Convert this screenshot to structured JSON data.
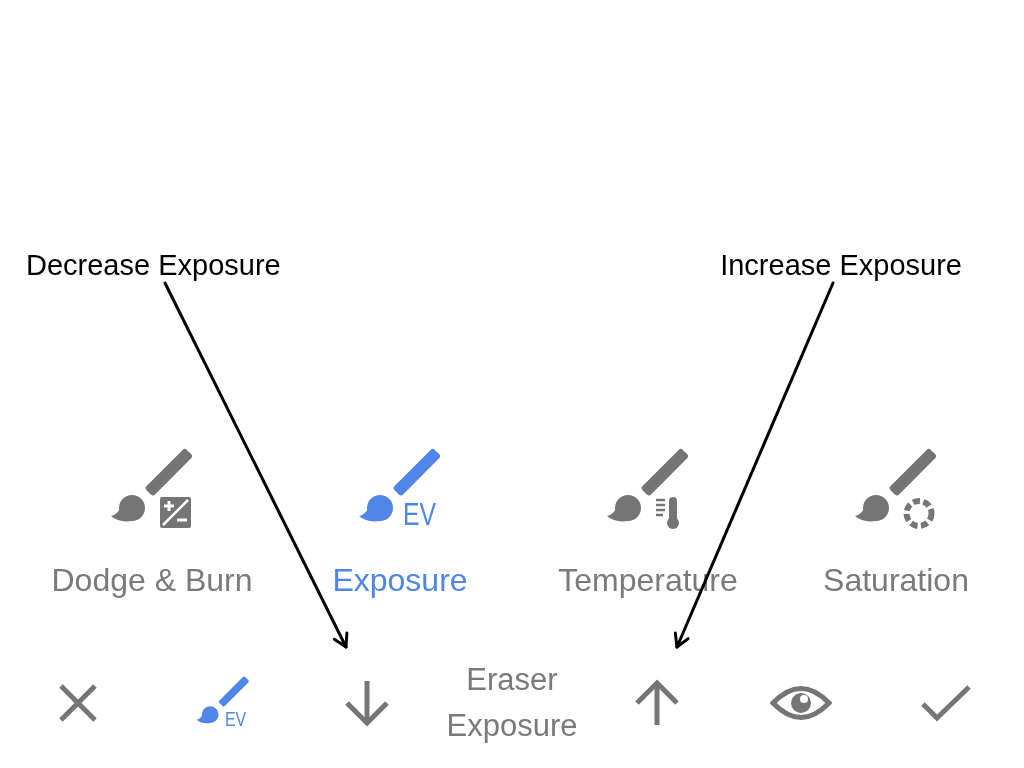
{
  "annotations": [
    {
      "text": "Decrease Exposure"
    },
    {
      "text": "Increase Exposure"
    }
  ],
  "tools": [
    {
      "kind": "dodge_burn",
      "label": "Dodge & Burn",
      "selected": false
    },
    {
      "kind": "exposure",
      "label": "Exposure",
      "icon_text": "EV",
      "selected": true
    },
    {
      "kind": "temperature",
      "label": "Temperature",
      "selected": false
    },
    {
      "kind": "saturation",
      "label": "Saturation",
      "selected": false
    }
  ],
  "bottom_bar": {
    "tool_icon_text": "EV",
    "mode_label": "Eraser Exposure"
  }
}
